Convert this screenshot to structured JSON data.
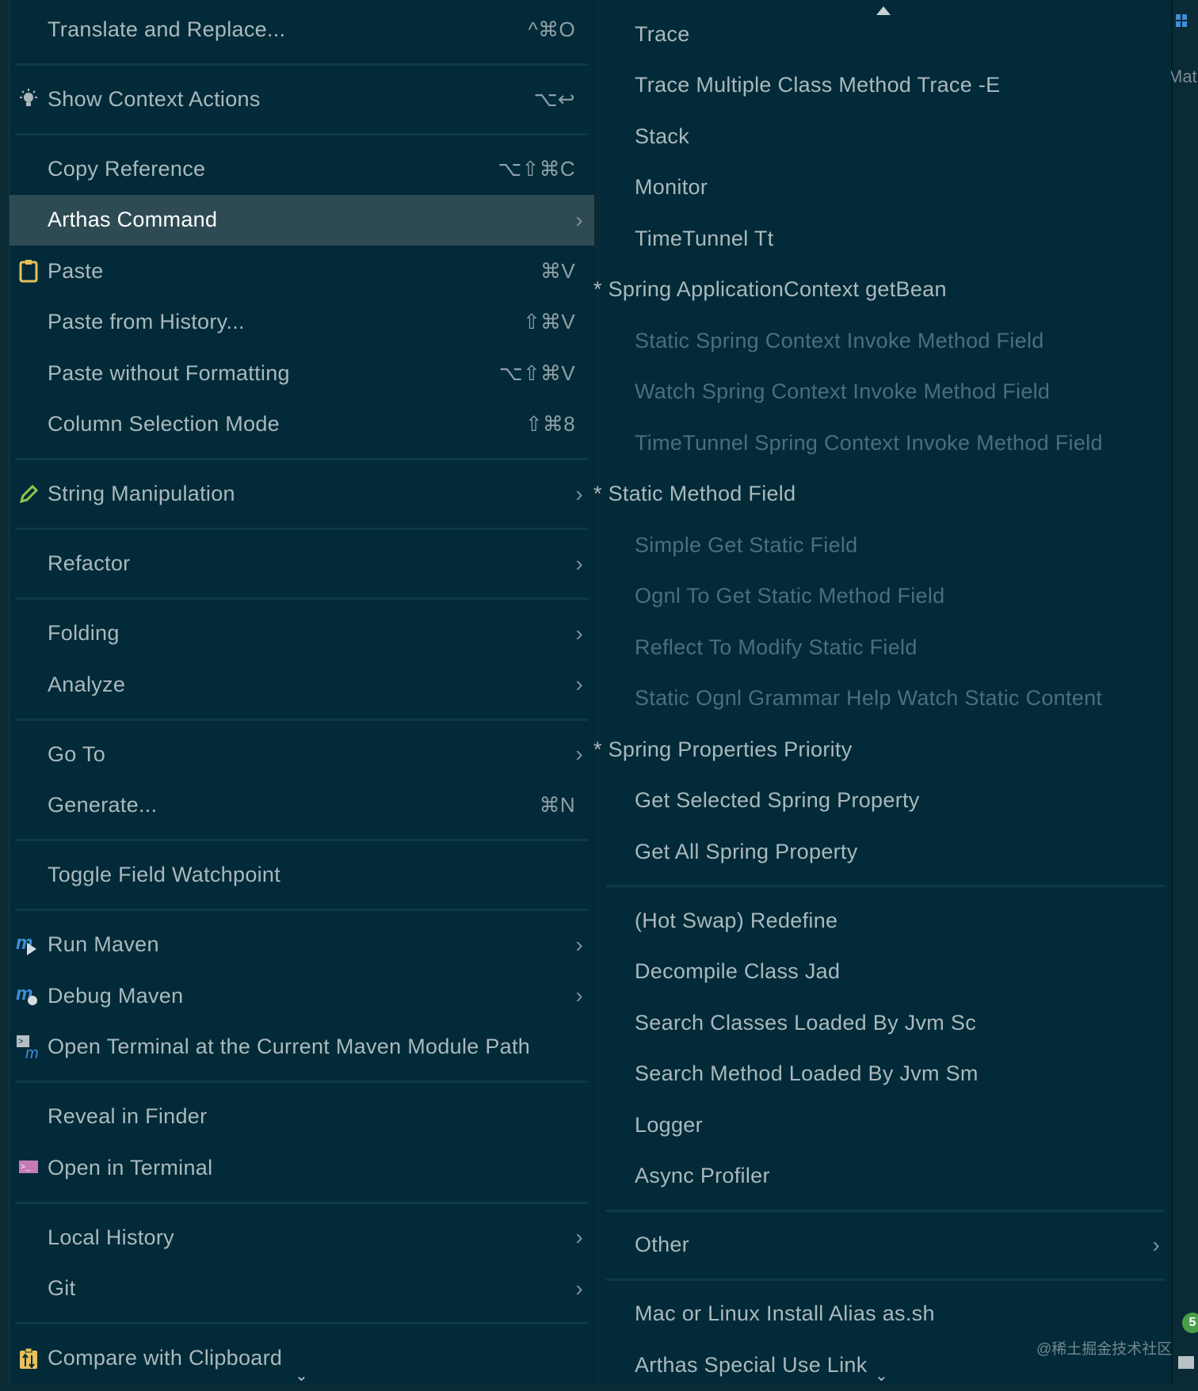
{
  "left_menu": [
    {
      "label": "Translate and Replace...",
      "shortcut": "^⌘O"
    },
    {
      "sep": true
    },
    {
      "label": "Show Context Actions",
      "shortcut": "⌥↩",
      "icon": "bulb"
    },
    {
      "sep": true
    },
    {
      "label": "Copy Reference",
      "shortcut": "⌥⇧⌘C"
    },
    {
      "label": "Arthas Command",
      "submenu": true,
      "highlighted": true
    },
    {
      "label": "Paste",
      "shortcut": "⌘V",
      "icon": "clipboard"
    },
    {
      "label": "Paste from History...",
      "shortcut": "⇧⌘V"
    },
    {
      "label": "Paste without Formatting",
      "shortcut": "⌥⇧⌘V"
    },
    {
      "label": "Column Selection Mode",
      "shortcut": "⇧⌘8"
    },
    {
      "sep": true
    },
    {
      "label": "String Manipulation",
      "submenu": true,
      "icon": "pencil"
    },
    {
      "sep": true
    },
    {
      "label": "Refactor",
      "submenu": true
    },
    {
      "sep": true
    },
    {
      "label": "Folding",
      "submenu": true
    },
    {
      "label": "Analyze",
      "submenu": true
    },
    {
      "sep": true
    },
    {
      "label": "Go To",
      "submenu": true
    },
    {
      "label": "Generate...",
      "shortcut": "⌘N"
    },
    {
      "sep": true
    },
    {
      "label": "Toggle Field Watchpoint"
    },
    {
      "sep": true
    },
    {
      "label": "Run Maven",
      "submenu": true,
      "icon": "maven-run"
    },
    {
      "label": "Debug Maven",
      "submenu": true,
      "icon": "maven-debug"
    },
    {
      "label": "Open Terminal at the Current Maven Module Path",
      "icon": "maven-terminal"
    },
    {
      "sep": true
    },
    {
      "label": "Reveal in Finder"
    },
    {
      "label": "Open in Terminal",
      "icon": "terminal"
    },
    {
      "sep": true
    },
    {
      "label": "Local History",
      "submenu": true
    },
    {
      "label": "Git",
      "submenu": true
    },
    {
      "sep": true
    },
    {
      "label": "Compare with Clipboard",
      "icon": "compare"
    }
  ],
  "right_menu": [
    {
      "label": "Trace"
    },
    {
      "label": "Trace Multiple Class Method Trace -E"
    },
    {
      "label": "Stack"
    },
    {
      "label": "Monitor"
    },
    {
      "label": "TimeTunnel Tt"
    },
    {
      "label": "* Spring ApplicationContext getBean",
      "star": true
    },
    {
      "label": "Static Spring Context Invoke  Method Field",
      "disabled": true
    },
    {
      "label": "Watch Spring Context Invoke Method Field",
      "disabled": true
    },
    {
      "label": "TimeTunnel Spring Context Invoke Method Field",
      "disabled": true
    },
    {
      "label": "*  Static Method Field",
      "star": true
    },
    {
      "label": "Simple Get Static Field",
      "disabled": true
    },
    {
      "label": "Ognl To Get Static Method Field",
      "disabled": true
    },
    {
      "label": "Reflect To Modify Static Field",
      "disabled": true
    },
    {
      "label": "Static Ognl Grammar Help Watch Static Content",
      "disabled": true
    },
    {
      "label": "*  Spring Properties Priority",
      "star": true
    },
    {
      "label": "Get Selected Spring Property"
    },
    {
      "label": "Get All Spring Property"
    },
    {
      "sep": true
    },
    {
      "label": "(Hot Swap)  Redefine"
    },
    {
      "label": "Decompile Class Jad"
    },
    {
      "label": "Search Classes Loaded By Jvm Sc"
    },
    {
      "label": "Search Method Loaded By Jvm Sm"
    },
    {
      "label": "Logger"
    },
    {
      "label": "Async Profiler"
    },
    {
      "sep": true
    },
    {
      "label": "Other",
      "submenu": true
    },
    {
      "sep": true
    },
    {
      "label": "Mac or Linux Install Alias as.sh"
    },
    {
      "label": "Arthas Special Use Link"
    }
  ],
  "side": {
    "right_text": "Mat",
    "badge": "5"
  },
  "watermark": "@稀土掘金技术社区",
  "colors": {
    "bg": "#032a38",
    "highlight": "#2e4b53",
    "text": "#a9b9bd",
    "disabled": "#4c6f79"
  }
}
